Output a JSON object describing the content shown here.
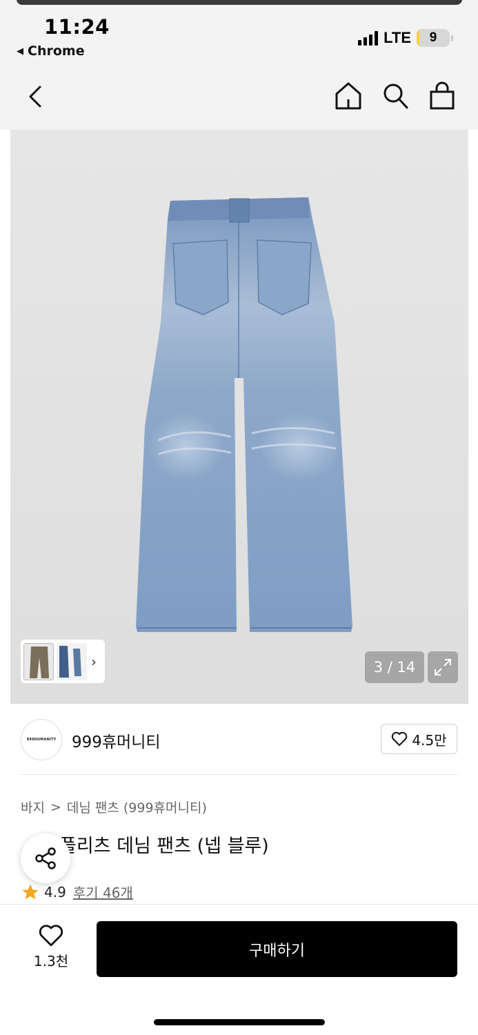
{
  "status_bar": {
    "time": "11:24",
    "back_app": "Chrome",
    "network": "LTE",
    "battery": "9",
    "battery_level": 0.09
  },
  "nav": {
    "icons": [
      "back-chevron-icon",
      "home-icon",
      "search-icon",
      "shopping-bag-icon"
    ]
  },
  "gallery": {
    "counter": "3 / 14",
    "thumb_more_icon": "chevron-right-icon",
    "expand_icon": "expand-icon"
  },
  "brand": {
    "logo_text": "999HUMANITY",
    "name": "999휴머니티",
    "likes": "4.5만"
  },
  "breadcrumb": {
    "category": "바지",
    "separator": ">",
    "subcategory": "데님 팬츠 (999휴머니티)"
  },
  "product": {
    "title_visible": "플리츠 데님 팬츠 (넵 블루)",
    "rating": "4.9",
    "reviews": "후기 46개"
  },
  "bottom_bar": {
    "wish_count": "1.3천",
    "buy_label": "구매하기"
  },
  "colors": {
    "accent_star": "#f5a623",
    "buy_button": "#000000",
    "denim": "#7d9dc2"
  }
}
